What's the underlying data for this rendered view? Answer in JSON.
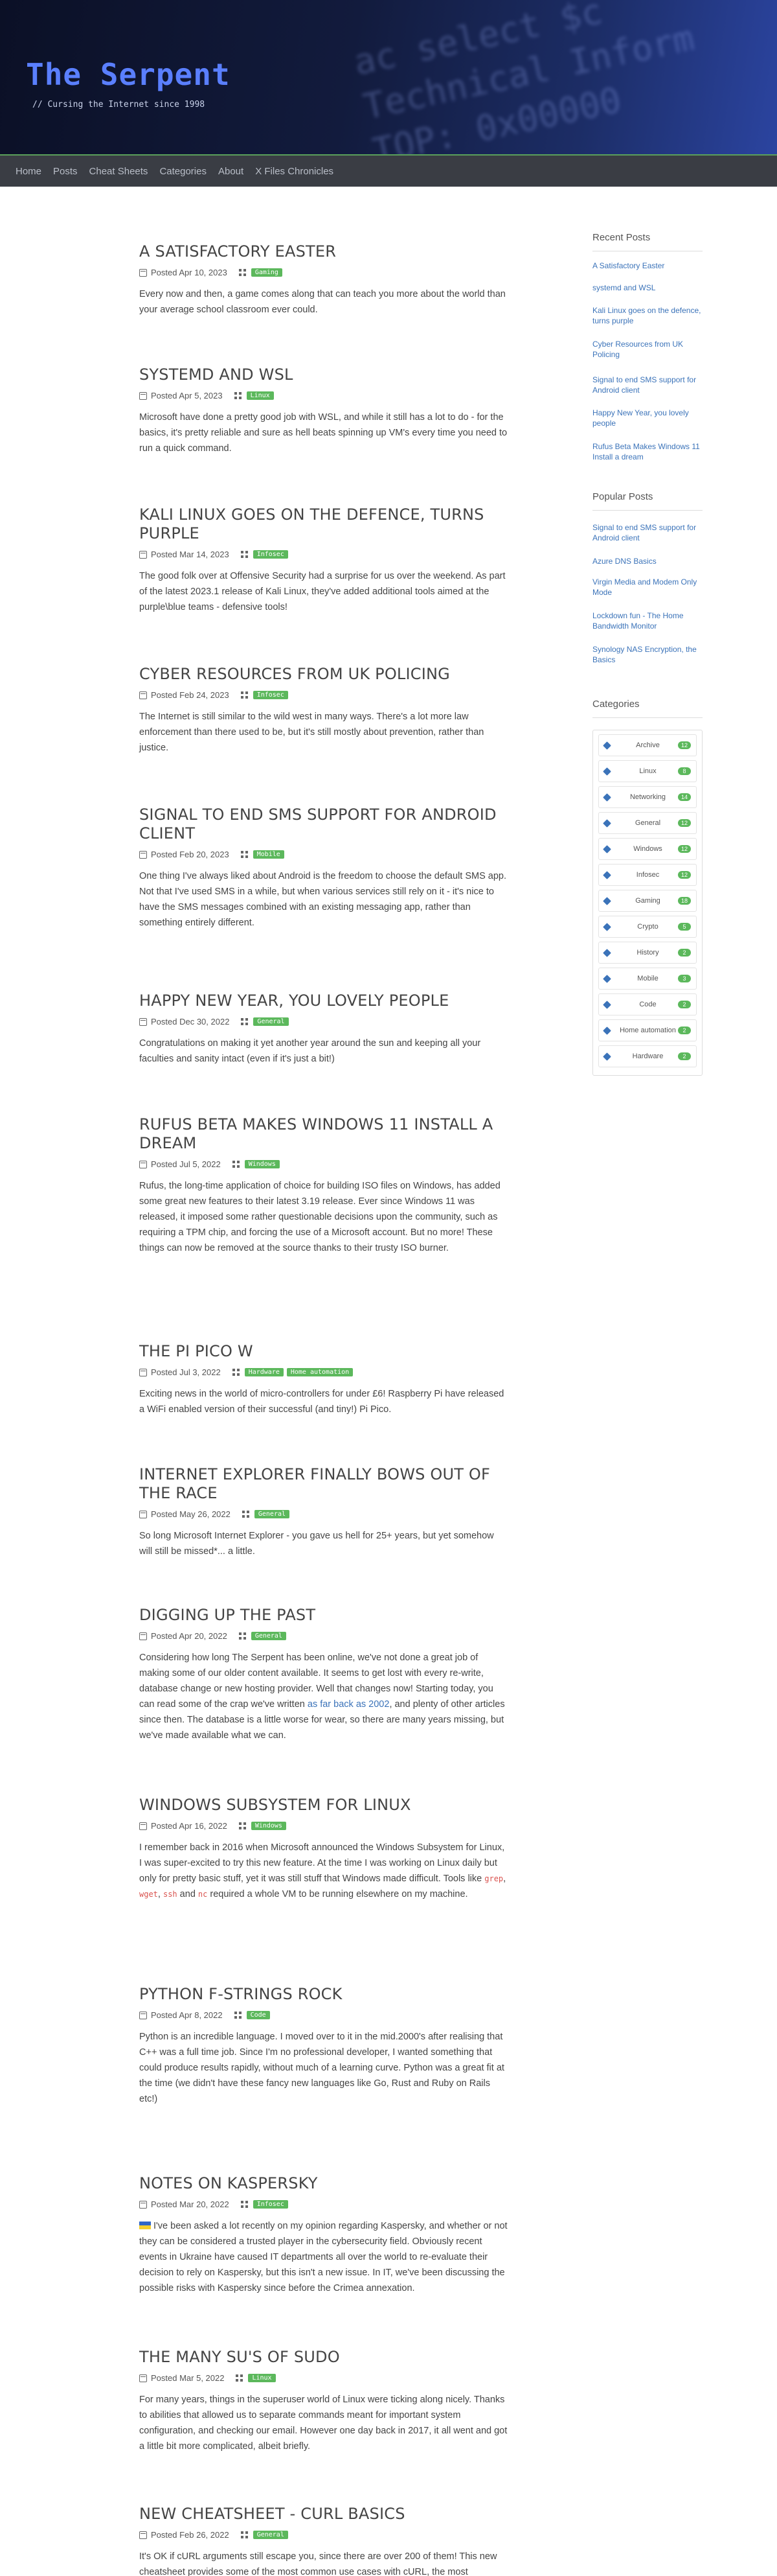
{
  "header": {
    "title": "The Serpent",
    "subtitle": "// Cursing the Internet since 1998",
    "bg_code_lines": [
      "ac  select $c",
      "Technical Inform",
      "TOP: 0x00000"
    ]
  },
  "nav": {
    "items": [
      "Home",
      "Posts",
      "Cheat Sheets",
      "Categories",
      "About",
      "X Files Chronicles"
    ]
  },
  "posts": [
    {
      "title": "A SATISFACTORY EASTER",
      "date": "Posted Apr 10, 2023",
      "tags": [
        "Gaming"
      ],
      "body": "Every now and then, a game comes along that can teach you more about the world than your average school classroom ever could."
    },
    {
      "title": "SYSTEMD AND WSL",
      "date": "Posted Apr 5, 2023",
      "tags": [
        "Linux"
      ],
      "body": "Microsoft have done a pretty good job with WSL, and while it still has a lot to do - for the basics, it's pretty reliable and sure as hell beats spinning up VM's every time you need to run a quick command."
    },
    {
      "title": "KALI LINUX GOES ON THE DEFENCE, TURNS PURPLE",
      "date": "Posted Mar 14, 2023",
      "tags": [
        "Infosec"
      ],
      "body": "The good folk over at Offensive Security had a surprise for us over the weekend. As part of the latest 2023.1 release of Kali Linux, they've added additional tools aimed at the purple\\blue teams - defensive tools!"
    },
    {
      "title": "CYBER RESOURCES FROM UK POLICING",
      "date": "Posted Feb 24, 2023",
      "tags": [
        "Infosec"
      ],
      "body": "The Internet is still similar to the wild west in many ways. There's a lot more law enforcement than there used to be, but it's still mostly about prevention, rather than justice."
    },
    {
      "title": "SIGNAL TO END SMS SUPPORT FOR ANDROID CLIENT",
      "date": "Posted Feb 20, 2023",
      "tags": [
        "Mobile"
      ],
      "body": "One thing I've always liked about Android is the freedom to choose the default SMS app. Not that I've used SMS in a while, but when various services still rely on it - it's nice to have the SMS messages combined with an existing messaging app, rather than something entirely different."
    },
    {
      "title": "HAPPY NEW YEAR, YOU LOVELY PEOPLE",
      "date": "Posted Dec 30, 2022",
      "tags": [
        "General"
      ],
      "body": "Congratulations on making it yet another year around the sun and keeping all your faculties and sanity intact (even if it's just a bit!)"
    },
    {
      "title": "RUFUS BETA MAKES WINDOWS 11 INSTALL A DREAM",
      "date": "Posted Jul 5, 2022",
      "tags": [
        "Windows"
      ],
      "body": "Rufus, the long-time application of choice for building ISO files on Windows, has added some great new features to their latest 3.19 release. Ever since Windows 11 was released, it imposed some rather questionable decisions upon the community, such as requiring a TPM chip, and forcing the use of a Microsoft account. But no more! These things can now be removed at the source thanks to their trusty ISO burner."
    },
    {
      "title": "THE PI PICO W",
      "date": "Posted Jul 3, 2022",
      "tags": [
        "Hardware",
        "Home automation"
      ],
      "body": "Exciting news in the world of micro-controllers for under £6! Raspberry Pi have released a WiFi enabled version of their successful (and tiny!) Pi Pico."
    },
    {
      "title": "INTERNET EXPLORER FINALLY BOWS OUT OF THE RACE",
      "date": "Posted May 26, 2022",
      "tags": [
        "General"
      ],
      "body": "So long Microsoft Internet Explorer - you gave us hell for 25+ years, but yet somehow will still be missed*... a little."
    },
    {
      "title": "DIGGING UP THE PAST",
      "date": "Posted Apr 20, 2022",
      "tags": [
        "General"
      ],
      "body_before": "Considering how long The Serpent has been online, we've not done a great job of making some of our older content available. It seems to get lost with every re-write, database change or new hosting provider. Well that changes now! Starting today, you can read some of the crap we've written ",
      "body_link": "as far back as 2002",
      "body_after": ", and plenty of other articles since then. The database is a little worse for wear, so there are many years missing, but we've made available what we can."
    },
    {
      "title": "WINDOWS SUBSYSTEM FOR LINUX",
      "date": "Posted Apr 16, 2022",
      "tags": [
        "Windows"
      ],
      "body_before": "I remember back in 2016 when Microsoft announced the Windows Subsystem for Linux, I was super-excited to try this new feature. At the time I was working on Linux daily but only for pretty basic stuff, yet it was still stuff that Windows made difficult. Tools like ",
      "codes": [
        "grep",
        "wget",
        "ssh",
        "nc"
      ],
      "body_after": " required a whole VM to be running elsewhere on my machine."
    },
    {
      "title": "PYTHON F-STRINGS ROCK",
      "date": "Posted Apr 8, 2022",
      "tags": [
        "Code"
      ],
      "body": "Python is an incredible language. I moved over to it in the mid.2000's after realising that C++ was a full time job. Since I'm no professional developer, I wanted something that could produce results rapidly, without much of a learning curve. Python was a great fit at the time (we didn't have these fancy new languages like Go, Rust and Ruby on Rails etc!)"
    },
    {
      "title": "NOTES ON KASPERSKY",
      "date": "Posted Mar 20, 2022",
      "tags": [
        "Infosec"
      ],
      "body": "I've been asked a lot recently on my opinion regarding Kaspersky, and whether or not they can be considered a trusted player in the cybersecurity field. Obviously recent events in Ukraine have caused IT departments all over the world to re-evaluate their decision to rely on Kaspersky, but this isn't a new issue. In IT, we've been discussing the possible risks with Kaspersky since before the Crimea annexation."
    },
    {
      "title": "THE MANY SU'S OF SUDO",
      "date": "Posted Mar 5, 2022",
      "tags": [
        "Linux"
      ],
      "body": "For many years, things in the superuser world of Linux were ticking along nicely. Thanks to abilities that allowed us to separate commands meant for important system configuration, and checking our email. However one day back in 2017, it all went and got a little bit more complicated, albeit briefly."
    },
    {
      "title": "NEW CHEATSHEET - CURL BASICS",
      "date": "Posted Feb 26, 2022",
      "tags": [
        "General"
      ],
      "body": "It's OK if cURL arguments still escape you, since there are over 200 of them! This new cheatsheet provides some of the most common use cases with cURL, the most comprehensive network tool for firing off HTTP(S) requests and interpreting their responses."
    }
  ],
  "sidebar": {
    "recent_heading": "Recent Posts",
    "recent": [
      "A Satisfactory Easter",
      "systemd and WSL",
      "Kali Linux goes on the defence, turns purple",
      "Cyber Resources from UK Policing",
      "Signal to end SMS support for Android client",
      "Happy New Year, you lovely people",
      "Rufus Beta Makes Windows 11 Install a dream"
    ],
    "popular_heading": "Popular Posts",
    "popular": [
      "Signal to end SMS support for Android client",
      "Azure DNS Basics",
      "Virgin Media and Modem Only Mode",
      "Lockdown fun - The Home Bandwidth Monitor",
      "Synology NAS Encryption, the Basics"
    ],
    "categories_heading": "Categories",
    "categories": [
      {
        "label": "Archive",
        "count": "12"
      },
      {
        "label": "Linux",
        "count": "8"
      },
      {
        "label": "Networking",
        "count": "14"
      },
      {
        "label": "General",
        "count": "12"
      },
      {
        "label": "Windows",
        "count": "12"
      },
      {
        "label": "Infosec",
        "count": "12"
      },
      {
        "label": "Gaming",
        "count": "18"
      },
      {
        "label": "Crypto",
        "count": "5"
      },
      {
        "label": "History",
        "count": "2"
      },
      {
        "label": "Mobile",
        "count": "3"
      },
      {
        "label": "Code",
        "count": "2"
      },
      {
        "label": "Home automation",
        "count": "2"
      },
      {
        "label": "Hardware",
        "count": "2"
      }
    ]
  },
  "colors": {
    "accent": "#5cb85c",
    "link": "#3b73b9",
    "title_blue": "#5a7fff",
    "nav_bg": "#3a3d44"
  }
}
